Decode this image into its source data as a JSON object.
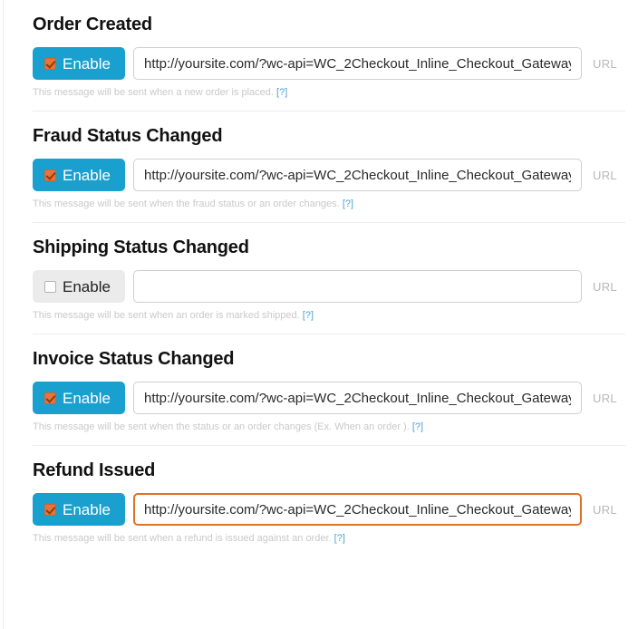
{
  "url_suffix_label": "URL",
  "enable_label": "Enable",
  "help_link_label": "[?]",
  "colors": {
    "enable_on_bg": "#19a0cf",
    "enable_off_bg": "#ebebeb",
    "checkbox_checked": "#e8743b",
    "focus_border": "#e0702c",
    "help_text": "#c9c9c9",
    "help_link": "#4fa3d1"
  },
  "sections": [
    {
      "title": "Order Created",
      "enabled": true,
      "url_value": "http://yoursite.com/?wc-api=WC_2Checkout_Inline_Checkout_Gateway",
      "help_text": "This message will be sent when a new order is placed.",
      "focused": false
    },
    {
      "title": "Fraud Status Changed",
      "enabled": true,
      "url_value": "http://yoursite.com/?wc-api=WC_2Checkout_Inline_Checkout_Gateway",
      "help_text": "This message will be sent when the fraud status or an order changes.",
      "focused": false
    },
    {
      "title": "Shipping Status Changed",
      "enabled": false,
      "url_value": "",
      "help_text": "This message will be sent when an order is marked shipped.",
      "focused": false
    },
    {
      "title": "Invoice Status Changed",
      "enabled": true,
      "url_value": "http://yoursite.com/?wc-api=WC_2Checkout_Inline_Checkout_Gateway",
      "help_text": "This message will be sent when the status or an order changes (Ex. When an order ).",
      "focused": false
    },
    {
      "title": "Refund Issued",
      "enabled": true,
      "url_value": "http://yoursite.com/?wc-api=WC_2Checkout_Inline_Checkout_Gateway",
      "help_text": "This message will be sent when a refund is issued against an order.",
      "focused": true
    }
  ]
}
